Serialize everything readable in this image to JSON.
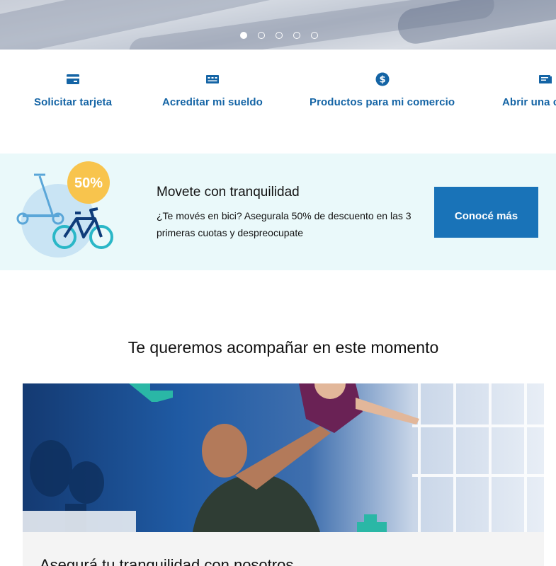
{
  "hero": {
    "carousel_dots": [
      {
        "active": true
      },
      {
        "active": false
      },
      {
        "active": false
      },
      {
        "active": false
      },
      {
        "active": false
      }
    ]
  },
  "quick_links": [
    {
      "label": "Solicitar tarjeta",
      "icon": "card-icon"
    },
    {
      "label": "Acreditar mi sueldo",
      "icon": "salary-icon"
    },
    {
      "label": "Productos para mi comercio",
      "icon": "dollar-coin-icon"
    },
    {
      "label": "Abrir una cuenta",
      "icon": "account-icon"
    }
  ],
  "promo": {
    "badge": "50%",
    "title": "Movete con tranquilidad",
    "description": "¿Te movés en bici? Asegurala 50% de descuento en las 3 primeras cuotas y despreocupate",
    "button_label": "Conocé más"
  },
  "section": {
    "title": "Te queremos acompañar en este momento"
  },
  "card": {
    "title": "Asegurá tu tranquilidad con nosotros"
  },
  "colors": {
    "link_blue": "#1464a5",
    "button_blue": "#1973b8",
    "promo_bg": "#eaf9fa"
  }
}
